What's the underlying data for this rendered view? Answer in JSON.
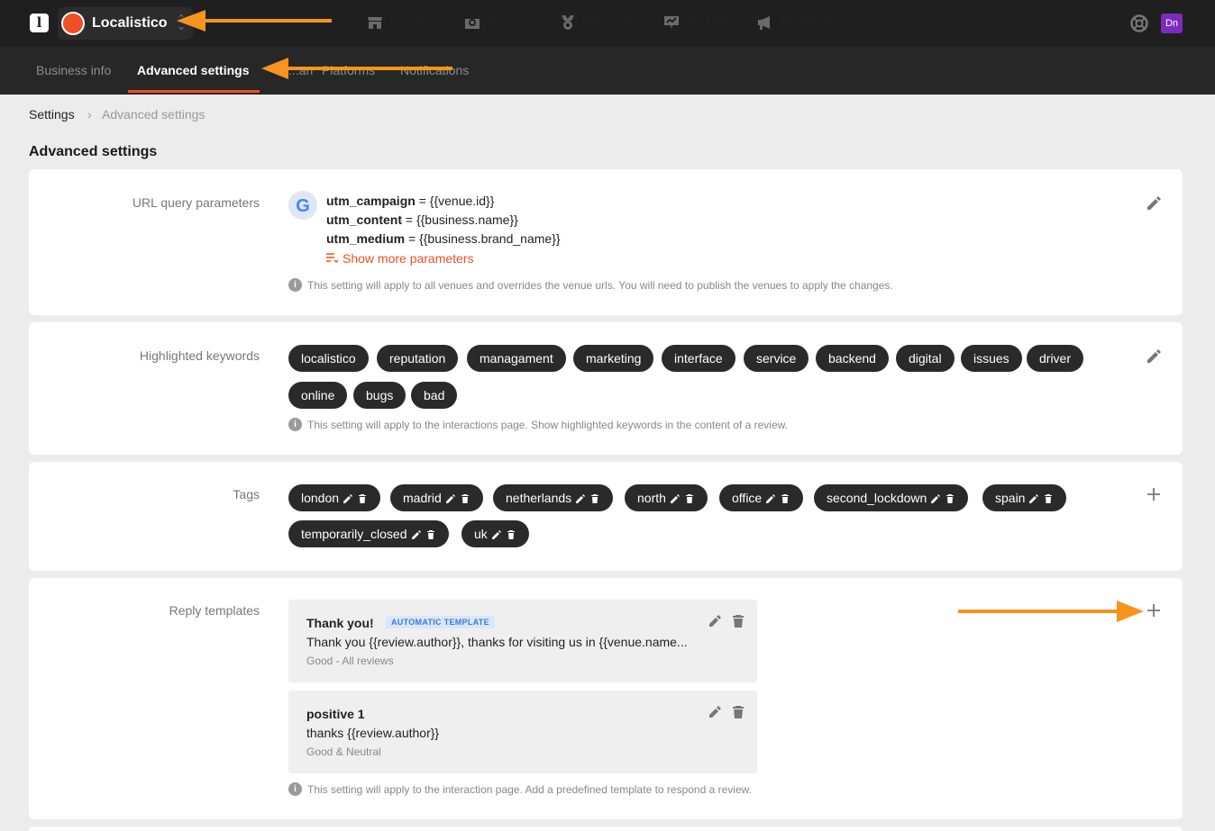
{
  "app": {
    "logo_letter": "l",
    "brand_name": "Localistico",
    "user_initials": "Dn"
  },
  "nav": {
    "items": [
      {
        "label": "Locations",
        "icon": "store-icon"
      },
      {
        "label": "Presence",
        "icon": "map-pin-icon"
      },
      {
        "label": "Reputation",
        "icon": "badge-icon"
      },
      {
        "label": "Analytics",
        "icon": "chart-icon"
      },
      {
        "label": "Promotions",
        "icon": "megaphone-icon"
      }
    ]
  },
  "subnav": {
    "tabs": [
      {
        "label": "Business info",
        "active": false
      },
      {
        "label": "Advanced settings",
        "active": true
      },
      {
        "label": "...an",
        "active": false
      },
      {
        "label": "Platforms",
        "active": false
      },
      {
        "label": "Notifications",
        "active": false
      }
    ]
  },
  "breadcrumb": {
    "root": "Settings",
    "separator": "›",
    "current": "Advanced settings"
  },
  "page": {
    "title": "Advanced settings"
  },
  "url_params": {
    "label": "URL query parameters",
    "params": [
      {
        "key": "utm_campaign",
        "value": " = {{venue.id}}"
      },
      {
        "key": "utm_content",
        "value": " = {{business.name}}"
      },
      {
        "key": "utm_medium",
        "value": " = {{business.brand_name}}"
      }
    ],
    "show_more": "Show more parameters",
    "note": "This setting will apply to all venues and overrides the venue urls. You will need to publish the venues to apply the changes."
  },
  "keywords": {
    "label": "Highlighted keywords",
    "items": [
      "localistico",
      "reputation",
      "managament",
      "marketing",
      "interface",
      "service",
      "backend",
      "digital",
      "issues",
      "driver",
      "online",
      "bugs",
      "bad"
    ],
    "note": "This setting will apply to the interactions page. Show highlighted keywords in the content of a review."
  },
  "tags": {
    "label": "Tags",
    "items": [
      "london",
      "madrid",
      "netherlands",
      "north",
      "office",
      "second_lockdown",
      "spain",
      "temporarily_closed",
      "uk"
    ]
  },
  "templates": {
    "label": "Reply templates",
    "items": [
      {
        "title": "Thank you!",
        "badge": "AUTOMATIC TEMPLATE",
        "text": "Thank you {{review.author}}, thanks for visiting us in {{venue.name...",
        "sub": "Good - All reviews"
      },
      {
        "title": "positive 1",
        "badge": "",
        "text": "thanks {{review.author}}",
        "sub": "Good & Neutral"
      }
    ],
    "note": "This setting will apply to the interaction page. Add a predefined template to respond a review."
  },
  "colors": {
    "accent": "#f04e23",
    "annotation_arrow": "#f7941d",
    "topbar": "#1f1f1f",
    "chip": "#2a2a2a"
  }
}
